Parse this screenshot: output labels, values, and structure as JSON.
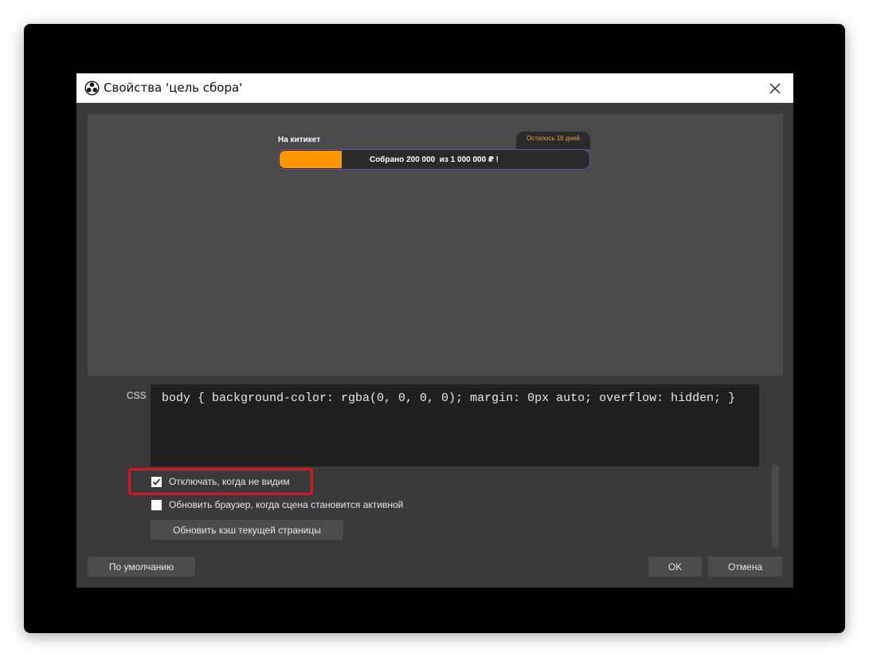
{
  "dialog": {
    "title": "Свойства 'цель сбора'",
    "icon": "obs-icon",
    "close_icon": "close-icon"
  },
  "preview": {
    "goal_title": "На китикет",
    "days_left": "Осталось 16 дней",
    "progress_text": "Собрано 200 000  из 1 000 000 ₽ !",
    "progress_fraction": 0.2,
    "fill_color": "#ff9800",
    "border_color": "#6b4fbf"
  },
  "css": {
    "label": "CSS",
    "value": "body { background-color: rgba(0, 0, 0, 0); margin: 0px auto; overflow: hidden; }"
  },
  "options": {
    "shutdown_label": "Отключать, когда не видим",
    "shutdown_checked": true,
    "refresh_label": "Обновить браузер, когда сцена становится активной",
    "refresh_checked": false,
    "refresh_cache_label": "Обновить кэш текущей страницы"
  },
  "footer": {
    "defaults_label": "По умолчанию",
    "ok_label": "OK",
    "cancel_label": "Отмена"
  },
  "colors": {
    "highlight": "#e0141e",
    "dialog_bg": "#3a3a3a"
  }
}
